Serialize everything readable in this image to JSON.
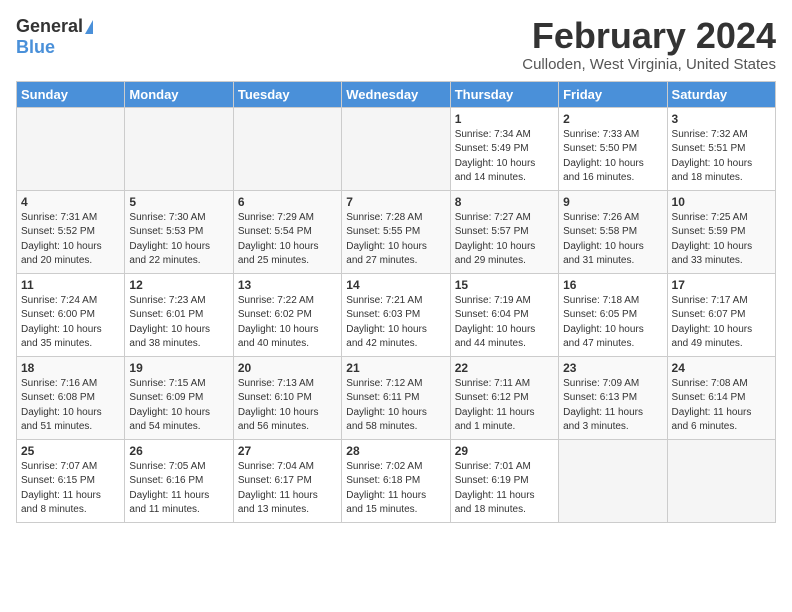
{
  "header": {
    "logo_general": "General",
    "logo_blue": "Blue",
    "month_title": "February 2024",
    "location": "Culloden, West Virginia, United States"
  },
  "days_of_week": [
    "Sunday",
    "Monday",
    "Tuesday",
    "Wednesday",
    "Thursday",
    "Friday",
    "Saturday"
  ],
  "weeks": [
    [
      {
        "day": "",
        "info": ""
      },
      {
        "day": "",
        "info": ""
      },
      {
        "day": "",
        "info": ""
      },
      {
        "day": "",
        "info": ""
      },
      {
        "day": "1",
        "info": "Sunrise: 7:34 AM\nSunset: 5:49 PM\nDaylight: 10 hours\nand 14 minutes."
      },
      {
        "day": "2",
        "info": "Sunrise: 7:33 AM\nSunset: 5:50 PM\nDaylight: 10 hours\nand 16 minutes."
      },
      {
        "day": "3",
        "info": "Sunrise: 7:32 AM\nSunset: 5:51 PM\nDaylight: 10 hours\nand 18 minutes."
      }
    ],
    [
      {
        "day": "4",
        "info": "Sunrise: 7:31 AM\nSunset: 5:52 PM\nDaylight: 10 hours\nand 20 minutes."
      },
      {
        "day": "5",
        "info": "Sunrise: 7:30 AM\nSunset: 5:53 PM\nDaylight: 10 hours\nand 22 minutes."
      },
      {
        "day": "6",
        "info": "Sunrise: 7:29 AM\nSunset: 5:54 PM\nDaylight: 10 hours\nand 25 minutes."
      },
      {
        "day": "7",
        "info": "Sunrise: 7:28 AM\nSunset: 5:55 PM\nDaylight: 10 hours\nand 27 minutes."
      },
      {
        "day": "8",
        "info": "Sunrise: 7:27 AM\nSunset: 5:57 PM\nDaylight: 10 hours\nand 29 minutes."
      },
      {
        "day": "9",
        "info": "Sunrise: 7:26 AM\nSunset: 5:58 PM\nDaylight: 10 hours\nand 31 minutes."
      },
      {
        "day": "10",
        "info": "Sunrise: 7:25 AM\nSunset: 5:59 PM\nDaylight: 10 hours\nand 33 minutes."
      }
    ],
    [
      {
        "day": "11",
        "info": "Sunrise: 7:24 AM\nSunset: 6:00 PM\nDaylight: 10 hours\nand 35 minutes."
      },
      {
        "day": "12",
        "info": "Sunrise: 7:23 AM\nSunset: 6:01 PM\nDaylight: 10 hours\nand 38 minutes."
      },
      {
        "day": "13",
        "info": "Sunrise: 7:22 AM\nSunset: 6:02 PM\nDaylight: 10 hours\nand 40 minutes."
      },
      {
        "day": "14",
        "info": "Sunrise: 7:21 AM\nSunset: 6:03 PM\nDaylight: 10 hours\nand 42 minutes."
      },
      {
        "day": "15",
        "info": "Sunrise: 7:19 AM\nSunset: 6:04 PM\nDaylight: 10 hours\nand 44 minutes."
      },
      {
        "day": "16",
        "info": "Sunrise: 7:18 AM\nSunset: 6:05 PM\nDaylight: 10 hours\nand 47 minutes."
      },
      {
        "day": "17",
        "info": "Sunrise: 7:17 AM\nSunset: 6:07 PM\nDaylight: 10 hours\nand 49 minutes."
      }
    ],
    [
      {
        "day": "18",
        "info": "Sunrise: 7:16 AM\nSunset: 6:08 PM\nDaylight: 10 hours\nand 51 minutes."
      },
      {
        "day": "19",
        "info": "Sunrise: 7:15 AM\nSunset: 6:09 PM\nDaylight: 10 hours\nand 54 minutes."
      },
      {
        "day": "20",
        "info": "Sunrise: 7:13 AM\nSunset: 6:10 PM\nDaylight: 10 hours\nand 56 minutes."
      },
      {
        "day": "21",
        "info": "Sunrise: 7:12 AM\nSunset: 6:11 PM\nDaylight: 10 hours\nand 58 minutes."
      },
      {
        "day": "22",
        "info": "Sunrise: 7:11 AM\nSunset: 6:12 PM\nDaylight: 11 hours\nand 1 minute."
      },
      {
        "day": "23",
        "info": "Sunrise: 7:09 AM\nSunset: 6:13 PM\nDaylight: 11 hours\nand 3 minutes."
      },
      {
        "day": "24",
        "info": "Sunrise: 7:08 AM\nSunset: 6:14 PM\nDaylight: 11 hours\nand 6 minutes."
      }
    ],
    [
      {
        "day": "25",
        "info": "Sunrise: 7:07 AM\nSunset: 6:15 PM\nDaylight: 11 hours\nand 8 minutes."
      },
      {
        "day": "26",
        "info": "Sunrise: 7:05 AM\nSunset: 6:16 PM\nDaylight: 11 hours\nand 11 minutes."
      },
      {
        "day": "27",
        "info": "Sunrise: 7:04 AM\nSunset: 6:17 PM\nDaylight: 11 hours\nand 13 minutes."
      },
      {
        "day": "28",
        "info": "Sunrise: 7:02 AM\nSunset: 6:18 PM\nDaylight: 11 hours\nand 15 minutes."
      },
      {
        "day": "29",
        "info": "Sunrise: 7:01 AM\nSunset: 6:19 PM\nDaylight: 11 hours\nand 18 minutes."
      },
      {
        "day": "",
        "info": ""
      },
      {
        "day": "",
        "info": ""
      }
    ]
  ]
}
